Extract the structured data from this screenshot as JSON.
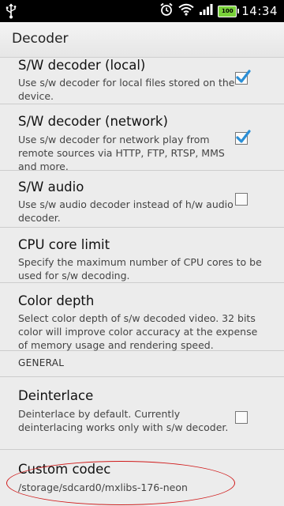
{
  "status_bar": {
    "time": "14:34",
    "battery_level": "100",
    "icons": [
      "usb-icon",
      "alarm-icon",
      "wifi-icon",
      "signal-icon",
      "battery-icon"
    ]
  },
  "action_bar": {
    "title": "Decoder"
  },
  "settings": [
    {
      "title": "S/W decoder (local)",
      "summary": "Use s/w decoder for local files stored on the device.",
      "checked": true
    },
    {
      "title": "S/W decoder (network)",
      "summary": "Use s/w decoder for network play from remote sources via HTTP, FTP, RTSP, MMS and more.",
      "checked": true
    },
    {
      "title": "S/W audio",
      "summary": "Use s/w audio decoder instead of h/w audio decoder.",
      "checked": false
    },
    {
      "title": "CPU core limit",
      "summary": "Specify the maximum number of CPU cores to be used for s/w decoding."
    },
    {
      "title": "Color depth",
      "summary": "Select color depth of s/w decoded video. 32 bits color will improve color accuracy at the expense of memory usage and rendering speed."
    }
  ],
  "general_section": {
    "label": "GENERAL"
  },
  "general": [
    {
      "title": "Deinterlace",
      "summary": "Deinterlace by default. Currently deinterlacing works only with s/w decoder.",
      "checked": false
    },
    {
      "title": "Custom codec",
      "summary": "/storage/sdcard0/mxlibs-176-neon"
    }
  ],
  "colors": {
    "check_accent": "#2b8fd6",
    "annotation_red": "#d01a1a"
  }
}
